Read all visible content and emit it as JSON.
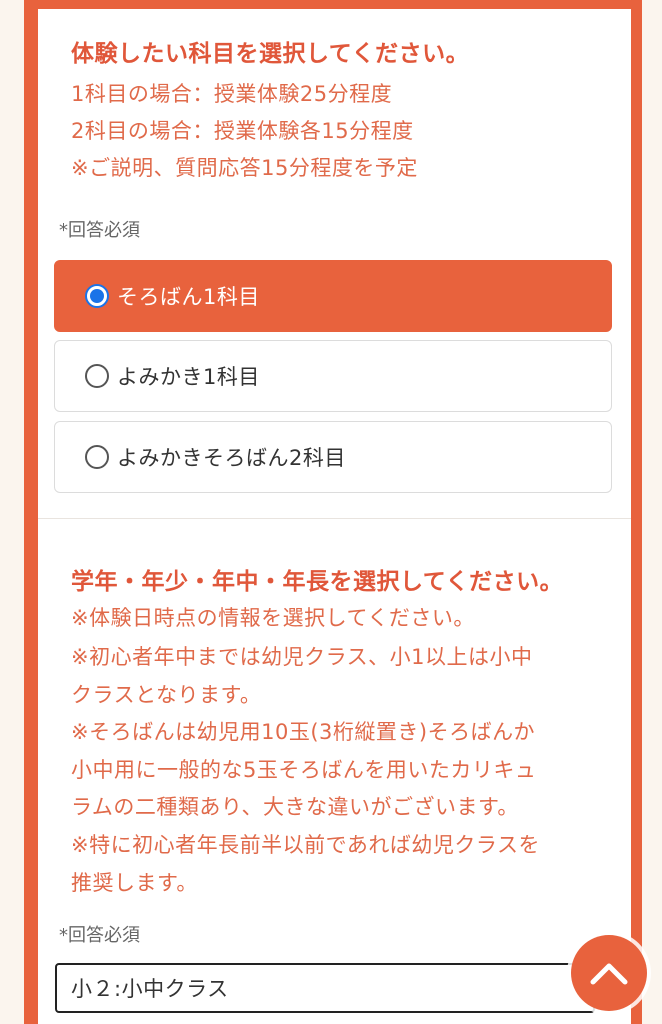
{
  "subject_section": {
    "title": "体験したい科目を選択してください。",
    "notes": [
      "1科目の場合：授業体験25分程度",
      "2科目の場合：授業体験各15分程度",
      "※ご説明、質問応答15分程度を予定"
    ],
    "required_label": "*回答必須",
    "options": [
      {
        "label": "そろばん1科目",
        "selected": true
      },
      {
        "label": "よみかき1科目",
        "selected": false
      },
      {
        "label": "よみかきそろばん2科目",
        "selected": false
      }
    ]
  },
  "grade_section": {
    "title": "学年・年少・年中・年長を選択してください。",
    "notes": [
      "※体験日時点の情報を選択してください。",
      "※初心者年中までは幼児クラス、小1以上は小中",
      "クラスとなります。",
      "※そろばんは幼児用10玉(3桁縦置き)そろばんか",
      "小中用に一般的な5玉そろばんを用いたカリキュ",
      "ラムの二種類あり、大きな違いがございます。",
      "※特に初心者年長前半以前であれば幼児クラスを",
      "推奨します。"
    ],
    "required_label": "*回答必須",
    "selected_value": "小２:小中クラス"
  },
  "icons": {
    "scroll_top": "chevron-up-icon"
  },
  "colors": {
    "accent": "#e8623d",
    "background": "#fbf5ee",
    "radio_checked": "#1a73e8"
  }
}
